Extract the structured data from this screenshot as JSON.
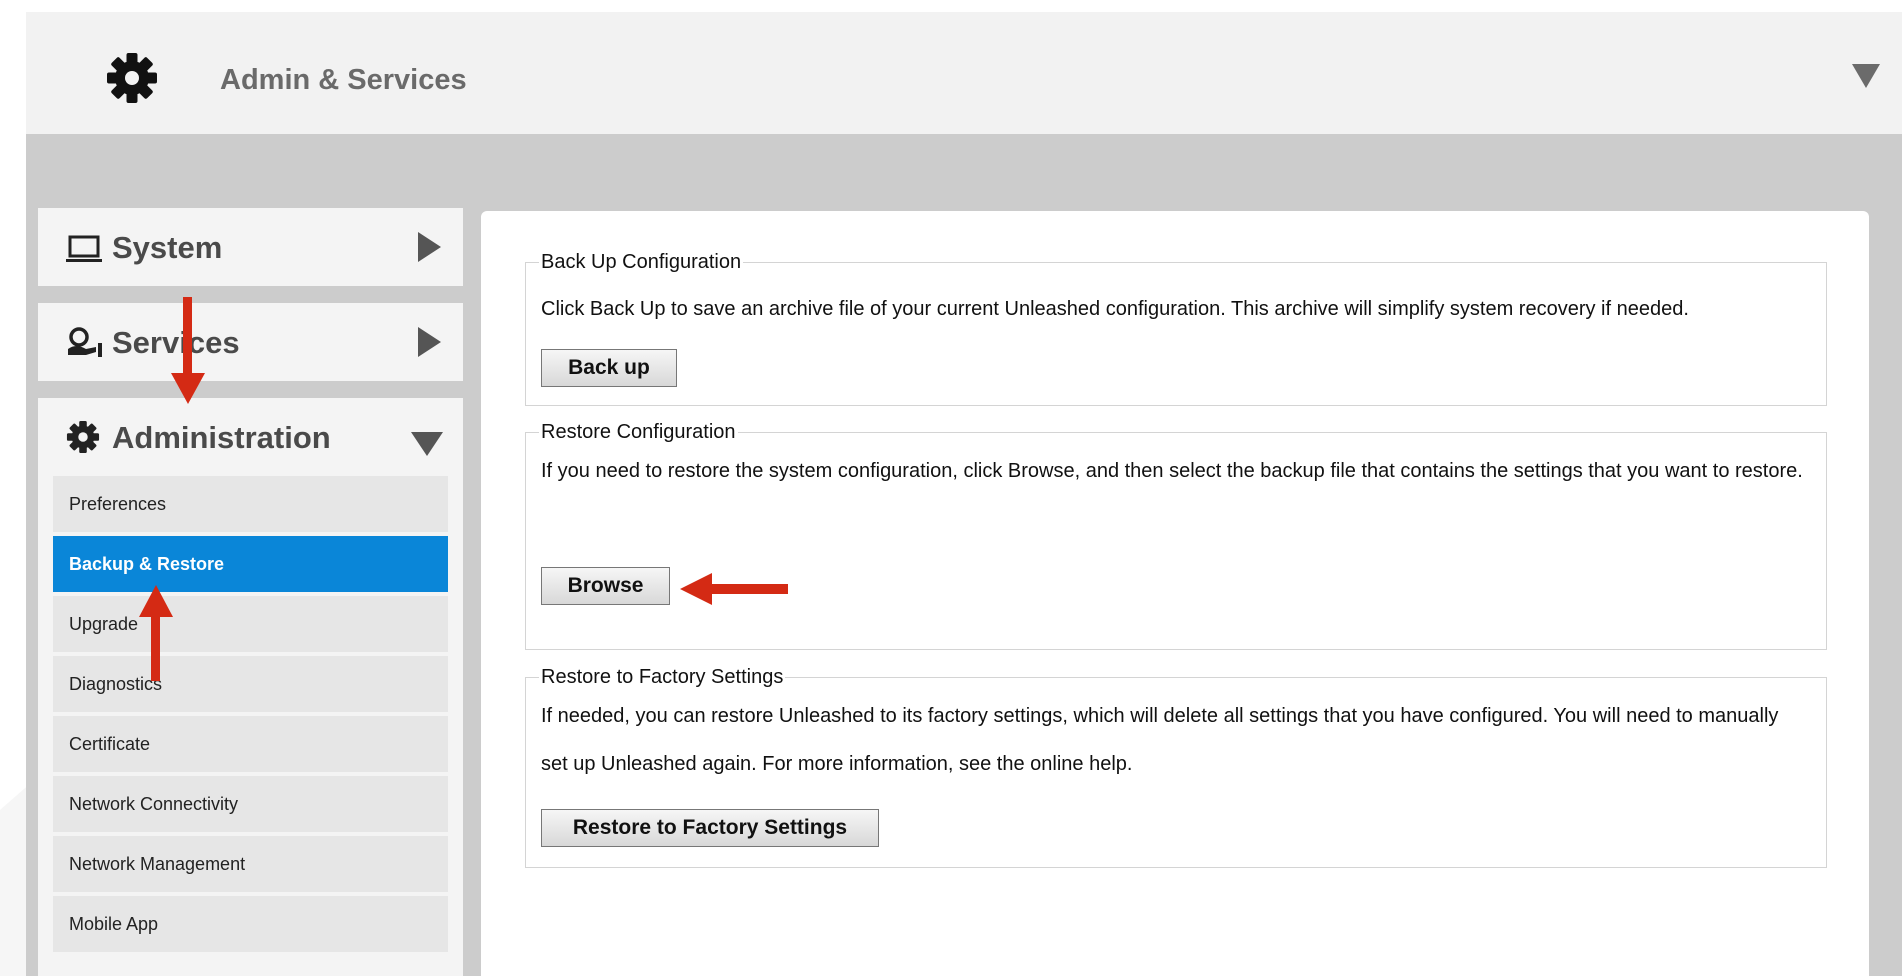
{
  "header": {
    "title": "Admin & Services",
    "icon": "gear-icon"
  },
  "sidebar": {
    "system": {
      "label": "System",
      "icon": "laptop-icon"
    },
    "services": {
      "label": "Services",
      "icon": "services-icon"
    },
    "administration": {
      "label": "Administration",
      "icon": "gear-icon",
      "items": [
        {
          "label": "Preferences"
        },
        {
          "label": "Backup & Restore",
          "active": true
        },
        {
          "label": "Upgrade"
        },
        {
          "label": "Diagnostics"
        },
        {
          "label": "Certificate"
        },
        {
          "label": "Network Connectivity"
        },
        {
          "label": "Network Management"
        },
        {
          "label": "Mobile App"
        }
      ]
    }
  },
  "main": {
    "backup": {
      "legend": "Back Up Configuration",
      "text": "Click Back Up to save an archive file of your current Unleashed configuration. This archive will simplify system recovery if needed.",
      "button": "Back up"
    },
    "restore": {
      "legend": "Restore Configuration",
      "text": "If you need to restore the system configuration, click Browse, and then select the backup file that contains the settings that you want to restore.",
      "button": "Browse"
    },
    "factory": {
      "legend": "Restore to Factory Settings",
      "text": "If needed, you can restore Unleashed to its factory settings, which will delete all settings that you have configured. You will need to manually set up Unleashed again. For more information, see the online help.",
      "button": "Restore to Factory Settings"
    }
  },
  "colors": {
    "active_item": "#0a86d8",
    "annotation_arrow": "#d42a14",
    "header_bg": "#f2f2f2",
    "gray_band": "#cccccc"
  }
}
